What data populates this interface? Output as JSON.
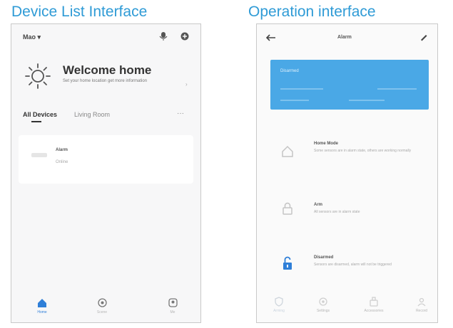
{
  "captions": {
    "left": "Device List Interface",
    "right": "Operation interface"
  },
  "left_phone": {
    "home_selector": "Mao ▾",
    "welcome": {
      "title": "Welcome home",
      "subtitle": "Set your home location get more information"
    },
    "tabs": [
      "All Devices",
      "Living Room"
    ],
    "more": "···",
    "device": {
      "name": "Alarm",
      "status": "Online"
    },
    "bottom_nav": [
      "Home",
      "Scene",
      "Me"
    ]
  },
  "right_phone": {
    "title": "Alarm",
    "banner": {
      "status": "Disarmed"
    },
    "modes": [
      {
        "title": "Home Mode",
        "desc": "Some sensors are in alarm state, others are working normally"
      },
      {
        "title": "Arm",
        "desc": "All sensors are in alarm state"
      },
      {
        "title": "Disarmed",
        "desc": "Sensors are disarmed, alarm will not be triggered"
      }
    ],
    "bottom_nav": [
      "Arming",
      "Settings",
      "Accessories",
      "Record"
    ]
  },
  "colors": {
    "caption": "#2f9bd6",
    "banner": "#4aa8e6",
    "nav_active": "#2f7fd8"
  }
}
